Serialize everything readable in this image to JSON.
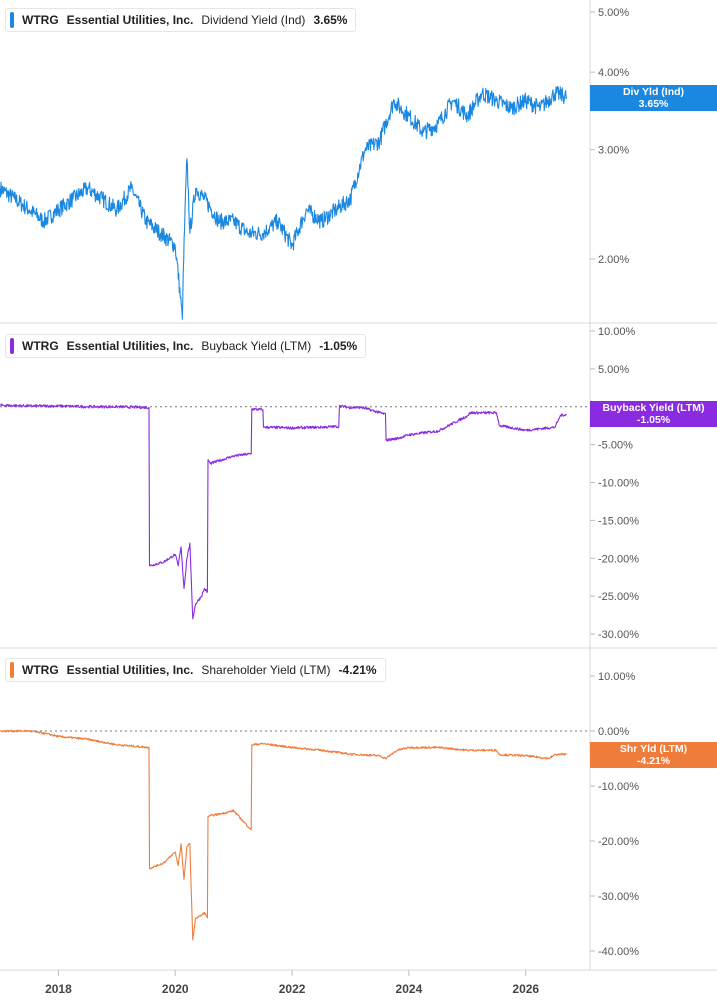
{
  "chart_data": [
    {
      "type": "line",
      "ticker": "WTRG",
      "company": "Essential Utilities, Inc.",
      "metric": "Dividend Yield (Ind)",
      "current_value": "3.65%",
      "badge_line1": "Div Yld (Ind)",
      "badge_line2": "3.65%",
      "color": "#1a87e0",
      "yscale": "log",
      "ylim": [
        1.5,
        5.2
      ],
      "yticks": [
        2,
        3,
        4,
        5
      ],
      "ytick_labels": [
        "2.00%",
        "3.00%",
        "4.00%",
        "5.00%"
      ],
      "series": [
        {
          "x": [
            2017.0,
            2017.25,
            2017.5,
            2017.75,
            2018.0,
            2018.25,
            2018.5,
            2018.75,
            2019.0,
            2019.25,
            2019.5,
            2019.75,
            2020.0,
            2020.12,
            2020.2,
            2020.25,
            2020.35,
            2020.5,
            2020.75,
            2021.0,
            2021.25,
            2021.5,
            2021.75,
            2022.0,
            2022.25,
            2022.5,
            2022.75,
            2023.0,
            2023.25,
            2023.5,
            2023.75,
            2023.85,
            2024.0,
            2024.25,
            2024.5,
            2024.75,
            2025.0,
            2025.25,
            2025.5,
            2025.75,
            2026.0,
            2026.25,
            2026.5,
            2026.7
          ],
          "y": [
            2.6,
            2.5,
            2.4,
            2.3,
            2.4,
            2.5,
            2.6,
            2.5,
            2.4,
            2.6,
            2.3,
            2.2,
            2.1,
            1.6,
            2.9,
            2.2,
            2.6,
            2.5,
            2.3,
            2.3,
            2.2,
            2.2,
            2.3,
            2.1,
            2.4,
            2.3,
            2.4,
            2.5,
            3.0,
            3.1,
            3.6,
            3.5,
            3.4,
            3.2,
            3.3,
            3.6,
            3.4,
            3.7,
            3.6,
            3.5,
            3.6,
            3.5,
            3.7,
            3.65
          ]
        }
      ]
    },
    {
      "type": "line",
      "ticker": "WTRG",
      "company": "Essential Utilities, Inc.",
      "metric": "Buyback Yield (LTM)",
      "current_value": "-1.05%",
      "badge_line1": "Buyback Yield (LTM)",
      "badge_line2": "-1.05%",
      "color": "#8a2be2",
      "yscale": "linear",
      "ylim": [
        -30.5,
        10.2
      ],
      "yticks": [
        10,
        5,
        -5,
        -10,
        -15,
        -20,
        -25,
        -30
      ],
      "ytick_labels": [
        "10.00%",
        "5.00%",
        "-5.00%",
        "-10.00%",
        "-15.00%",
        "-20.00%",
        "-25.00%",
        "-30.00%"
      ],
      "zero_line": true,
      "series": [
        {
          "x": [
            2017.0,
            2017.5,
            2018.0,
            2018.5,
            2019.0,
            2019.55,
            2019.56,
            2019.8,
            2020.0,
            2020.05,
            2020.1,
            2020.15,
            2020.2,
            2020.25,
            2020.3,
            2020.35,
            2020.45,
            2020.5,
            2020.55,
            2020.56,
            2020.6,
            2020.8,
            2021.0,
            2021.3,
            2021.31,
            2021.5,
            2021.51,
            2022.0,
            2022.5,
            2022.8,
            2022.81,
            2023.0,
            2023.2,
            2023.6,
            2023.61,
            2023.8,
            2024.0,
            2024.4,
            2024.5,
            2025.0,
            2025.05,
            2025.5,
            2025.55,
            2026.0,
            2026.5,
            2026.6,
            2026.7
          ],
          "y": [
            0.2,
            0.1,
            0.1,
            0.0,
            0.0,
            -0.1,
            -21.0,
            -20.5,
            -19.5,
            -21.0,
            -18.5,
            -24.0,
            -20.0,
            -18.0,
            -28.0,
            -26.0,
            -25.0,
            -24.0,
            -24.5,
            -7.0,
            -7.5,
            -7.0,
            -6.5,
            -6.2,
            -0.3,
            -0.4,
            -2.7,
            -2.8,
            -2.7,
            -2.6,
            0.1,
            -0.1,
            -0.1,
            -1.0,
            -4.4,
            -4.2,
            -3.7,
            -3.3,
            -3.2,
            -1.2,
            -0.8,
            -0.8,
            -2.5,
            -3.1,
            -2.7,
            -1.1,
            -1.05
          ]
        }
      ]
    },
    {
      "type": "line",
      "ticker": "WTRG",
      "company": "Essential Utilities, Inc.",
      "metric": "Shareholder Yield (LTM)",
      "current_value": "-4.21%",
      "badge_line1": "Shr Yld (LTM)",
      "badge_line2": "-4.21%",
      "color": "#f07c3c",
      "yscale": "linear",
      "ylim": [
        -41,
        12
      ],
      "yticks": [
        10,
        0,
        -10,
        -20,
        -30,
        -40
      ],
      "ytick_labels": [
        "10.00%",
        "0.00%",
        "-10.00%",
        "-20.00%",
        "-30.00%",
        "-40.00%"
      ],
      "zero_line": true,
      "series": [
        {
          "x": [
            2017.0,
            2017.5,
            2017.8,
            2018.0,
            2018.5,
            2019.0,
            2019.55,
            2019.56,
            2019.8,
            2020.0,
            2020.05,
            2020.1,
            2020.15,
            2020.2,
            2020.25,
            2020.3,
            2020.35,
            2020.45,
            2020.5,
            2020.55,
            2020.56,
            2020.8,
            2021.0,
            2021.3,
            2021.31,
            2021.5,
            2022.0,
            2022.5,
            2023.0,
            2023.5,
            2023.6,
            2023.8,
            2024.0,
            2024.5,
            2025.0,
            2025.5,
            2025.55,
            2026.0,
            2026.4,
            2026.5,
            2026.7
          ],
          "y": [
            0.0,
            0.0,
            -0.5,
            -1.0,
            -1.5,
            -2.5,
            -3.0,
            -25.0,
            -24.0,
            -22.0,
            -24.5,
            -20.5,
            -27.0,
            -21.0,
            -20.5,
            -38.0,
            -34.0,
            -33.5,
            -33.0,
            -34.0,
            -15.5,
            -15.0,
            -14.5,
            -18.0,
            -2.5,
            -2.3,
            -3.0,
            -3.5,
            -4.2,
            -4.5,
            -5.0,
            -3.5,
            -3.0,
            -3.0,
            -3.5,
            -3.5,
            -4.3,
            -4.5,
            -5.0,
            -4.3,
            -4.21
          ]
        }
      ]
    }
  ],
  "x_axis": {
    "xlim": [
      2017.0,
      2027.1
    ],
    "ticks": [
      2018,
      2020,
      2022,
      2024,
      2026
    ],
    "tick_labels": [
      "2018",
      "2020",
      "2022",
      "2024",
      "2026"
    ]
  }
}
